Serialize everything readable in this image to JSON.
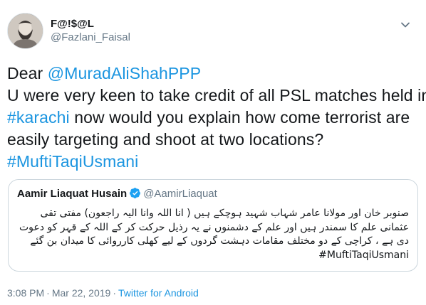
{
  "author": {
    "display_name": "F@!$@L",
    "handle": "@Fazlani_Faisal"
  },
  "tweet": {
    "greeting": "Dear ",
    "mention": "@MuradAliShahPPP",
    "line2": "U were very keen to take credit of all PSL matches held in",
    "hashtag_karachi": "#karachi",
    "line3_rest": " now would you explain how come terrorist are",
    "line4": "easily targeting and shoot at two locations?",
    "hashtag_mufti": "#MuftiTaqiUsmani"
  },
  "quoted_tweet": {
    "display_name": "Aamir Liaquat Husain",
    "handle": "@AamirLiaquat",
    "lines": [
      "صنوبر خان اور مولانا عامر شہاب شہید ہوچکے ہیں ( انا اللہ وانا الیہ راجعون) مفتی تقی",
      "عثمانی علم کا سمندر ہیں اور علم کے دشمنوں نے یہ رذیل حرکت کر کے اللہ کے قہر کو دعوت",
      "دی ہے ، کراچی کے دو مختلف مقامات دہشت گردوں کے لیے کھلی کارروائی کا میدان بن گئے"
    ],
    "hashtag": "#MuftiTaqiUsmani"
  },
  "meta": {
    "time": "3:08 PM",
    "separator1": "·",
    "date": "Mar 22, 2019",
    "separator2": "·",
    "source": "Twitter for Android"
  },
  "colors": {
    "link": "#1b95e0",
    "secondary_text": "#657786",
    "border": "#ccd6dd",
    "verified": "#1da1f2"
  },
  "icons": [
    "avatar",
    "chevron-down-icon",
    "verified-badge-icon"
  ]
}
